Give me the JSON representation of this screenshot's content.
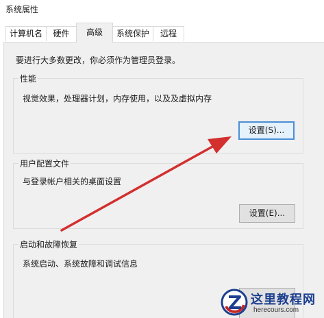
{
  "window": {
    "title": "系统属性"
  },
  "tabs": [
    {
      "label": "计算机名"
    },
    {
      "label": "硬件"
    },
    {
      "label": "高级",
      "active": true
    },
    {
      "label": "系统保护"
    },
    {
      "label": "远程"
    }
  ],
  "admin_notice": "要进行大多数更改，你必须作为管理员登录。",
  "performance": {
    "title": "性能",
    "description": "视觉效果，处理器计划，内存使用，以及及虚拟内存",
    "button": "设置(S)..."
  },
  "user_profiles": {
    "title": "用户配置文件",
    "description": "与登录帐户相关的桌面设置",
    "button": "设置(E)..."
  },
  "startup_recovery": {
    "title": "启动和故障恢复",
    "description": "系统启动、系统故障和调试信息"
  },
  "watermark": {
    "name": "这里教程网",
    "url": "herecours.com"
  },
  "colors": {
    "arrow": "#d32f2f",
    "focus_border": "#4a8ed6",
    "panel_bg": "#f0f0f0"
  }
}
